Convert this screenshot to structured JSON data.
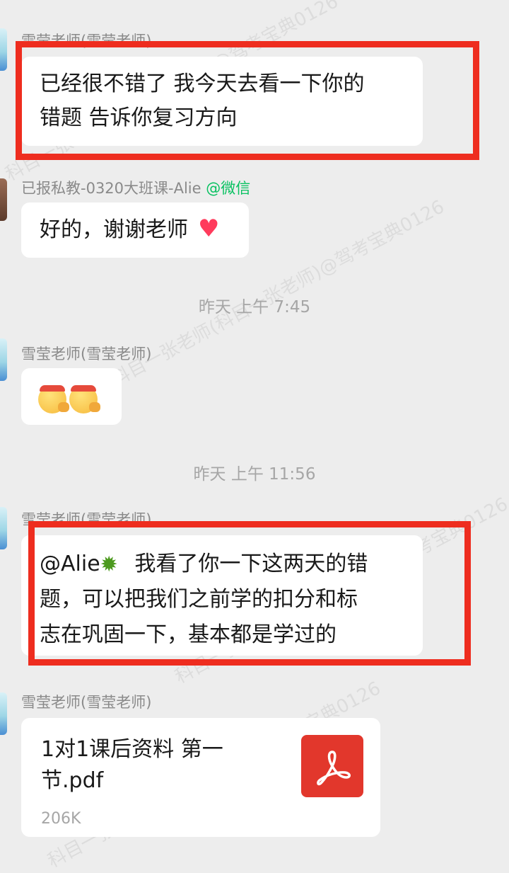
{
  "messages": [
    {
      "sender": "雪莹老师(雪莹老师)",
      "lines": [
        "已经很不错了 我今天去看一下你的",
        "错题 告诉你复习方向"
      ]
    },
    {
      "sender": "已报私教-0320大班课-Alie",
      "sender_tag": "@微信",
      "text": "好的，谢谢老师",
      "icon": "heart-emoji"
    },
    {
      "sender": "雪莹老师(雪莹老师)",
      "icons": [
        "saluting-face-emoji",
        "saluting-face-emoji"
      ]
    },
    {
      "sender": "雪莹老师(雪莹老师)",
      "mention": "@Alie",
      "mention_icon": "virus-emoji",
      "lines": [
        "我看了你一下这两天的错",
        "题，可以把我们之前学的扣分和标",
        "志在巩固一下，基本都是学过的"
      ]
    },
    {
      "sender": "雪莹老师(雪莹老师)",
      "file": {
        "name_line1": "1对1课后资料  第一",
        "name_line2": "节.pdf",
        "size": "206K",
        "icon": "pdf-icon"
      }
    }
  ],
  "timestamps": [
    "昨天  上午 7:45",
    "昨天  上午 11:56"
  ],
  "watermark": "科目一张老师(科目一张老师)@驾考宝典0126",
  "colors": {
    "highlight_box": "#ee2d1f",
    "wechat_tag": "#07c160",
    "background": "#ededed"
  }
}
